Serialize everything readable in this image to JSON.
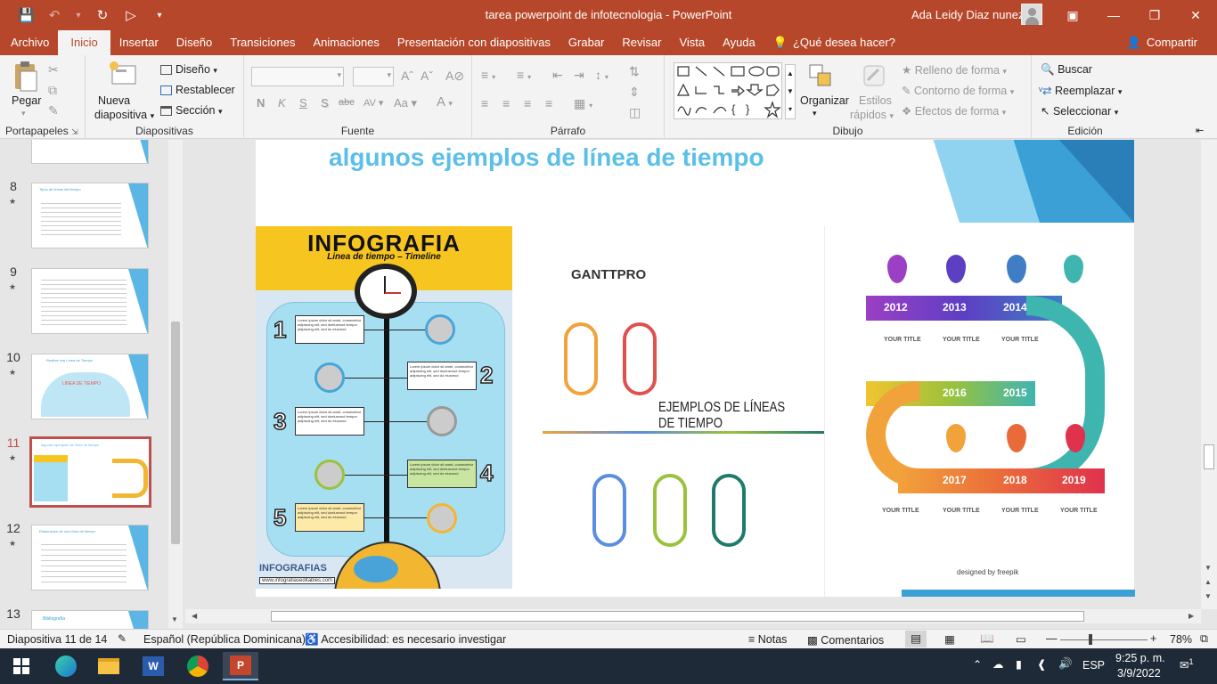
{
  "window": {
    "title": "tarea powerpoint de infotecnologia  -  PowerPoint",
    "user": "Ada Leidy Diaz nunez"
  },
  "menu": {
    "tabs": [
      "Archivo",
      "Inicio",
      "Insertar",
      "Diseño",
      "Transiciones",
      "Animaciones",
      "Presentación con diapositivas",
      "Grabar",
      "Revisar",
      "Vista",
      "Ayuda"
    ],
    "active": "Inicio",
    "tell_me": "¿Qué desea hacer?",
    "share": "Compartir"
  },
  "ribbon": {
    "portapapeles": {
      "label": "Portapapeles",
      "paste": "Pegar"
    },
    "diapositivas": {
      "label": "Diapositivas",
      "new_slide_1": "Nueva",
      "new_slide_2": "diapositiva",
      "layout": "Diseño",
      "reset": "Restablecer",
      "section": "Sección"
    },
    "fuente": {
      "label": "Fuente",
      "bold": "N",
      "italic": "K",
      "underline": "S",
      "shadow": "S",
      "strike": "abc",
      "spacing": "AV",
      "case": "Aa"
    },
    "parrafo": {
      "label": "Párrafo"
    },
    "dibujo": {
      "label": "Dibujo",
      "arrange": "Organizar",
      "quick_styles_1": "Estilos",
      "quick_styles_2": "rápidos",
      "fill": "Relleno de forma",
      "outline": "Contorno de forma",
      "effects": "Efectos de forma"
    },
    "edicion": {
      "label": "Edición",
      "find": "Buscar",
      "replace": "Reemplazar",
      "select": "Seleccionar"
    }
  },
  "thumbnails": [
    {
      "num": "8",
      "title": "Tipos de líneas del tiempo"
    },
    {
      "num": "9",
      "title": ""
    },
    {
      "num": "10",
      "title": "Realiza una Línea de Tiempo",
      "inner": "LÍNEA DE TIEMPO"
    },
    {
      "num": "11",
      "title": "algunos ejemplos de línea de tiempo",
      "selected": true
    },
    {
      "num": "12",
      "title": "Elaboración de una línea de tiempo"
    },
    {
      "num": "13",
      "title": "Bibliografía"
    }
  ],
  "slide": {
    "title": "algunos ejemplos de línea de tiempo",
    "infografia": {
      "heading": "INFOGRAFIA",
      "subheading": "Linea de tiempo – Timeline",
      "card_text": "Lorem ipsum dolor sit amet, consectetur adipiscing elit, sed doeiusmod tempor adipiscing elit, sed do eiusmod",
      "numbers": [
        "1",
        "2",
        "3",
        "4",
        "5"
      ],
      "logo": "INFOGRAFIAS",
      "url": "www.infografiaseditables.com"
    },
    "ganttpro": {
      "brand": "GANTTPRO",
      "heading": "EJEMPLOS DE LÍNEAS DE TIEMPO"
    },
    "years": {
      "top": [
        "2012",
        "2013",
        "2014"
      ],
      "middle": [
        "2016",
        "2015"
      ],
      "bottom": [
        "2017",
        "2018",
        "2019"
      ],
      "label": "YOUR TITLE",
      "credit": "designed by freepik"
    }
  },
  "status": {
    "slide_info": "Diapositiva 11 de 14",
    "language": "Español (República Dominicana)",
    "accessibility": "Accesibilidad: es necesario investigar",
    "notes": "Notas",
    "comments": "Comentarios",
    "zoom": "78%"
  },
  "taskbar": {
    "lang": "ESP",
    "time": "9:25 p. m.",
    "date": "3/9/2022",
    "notif": "1"
  },
  "colors": {
    "accent": "#b7472a",
    "title_blue": "#5bbfe8",
    "selected_border": "#c0504d"
  }
}
